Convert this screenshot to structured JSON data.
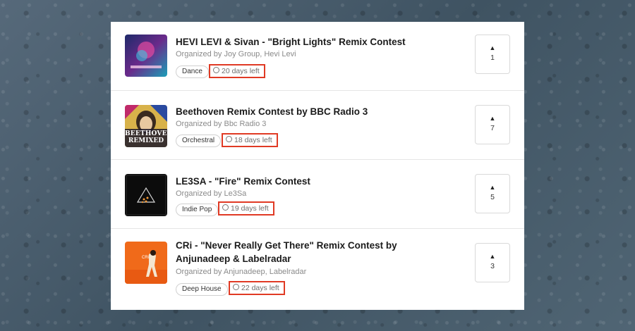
{
  "contests": [
    {
      "title": "HEVI LEVI & Sivan - \"Bright Lights\" Remix Contest",
      "organizer": "Organized by Joy Group, Hevi Levi",
      "genre": "Dance",
      "days_left": "20 days left",
      "votes": "1",
      "vote_icon": "▲"
    },
    {
      "title": "Beethoven Remix Contest by BBC Radio 3",
      "organizer": "Organized by Bbc Radio 3",
      "genre": "Orchestral",
      "days_left": "18 days left",
      "votes": "7",
      "vote_icon": "▲",
      "art_text_1": "BEETHOVEN",
      "art_text_2": "REMIXED"
    },
    {
      "title": "LE3SA - \"Fire\" Remix Contest",
      "organizer": "Organized by Le3Sa",
      "genre": "Indie Pop",
      "days_left": "19 days left",
      "votes": "5",
      "vote_icon": "▲"
    },
    {
      "title": "CRi - \"Never Really Get There\" Remix Contest by Anjunadeep & Labelradar",
      "organizer": "Organized by Anjunadeep, Labelradar",
      "genre": "Deep House",
      "days_left": "22 days left",
      "votes": "3",
      "vote_icon": "▲",
      "art_text_1": "CRi"
    }
  ],
  "colors": {
    "highlight": "#e03a24",
    "panel_bg": "#ffffff",
    "page_bg": "#4b5f6b"
  }
}
